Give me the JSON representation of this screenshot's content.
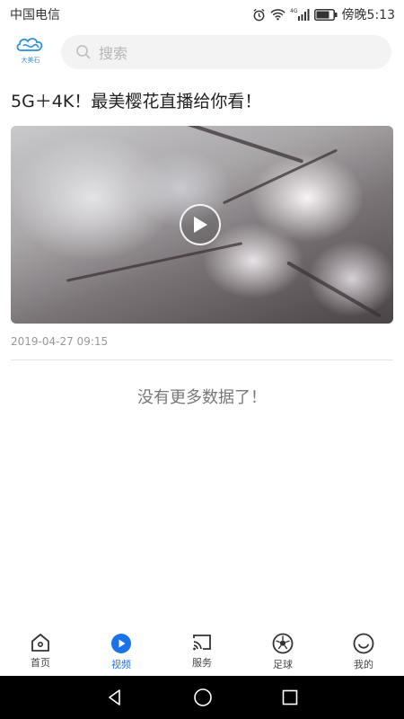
{
  "status_bar": {
    "carrier": "中国电信",
    "time": "傍晚5:13",
    "network": "4G"
  },
  "header": {
    "logo_text": "大美石",
    "search_placeholder": "搜索"
  },
  "article": {
    "title": "5G＋4K！最美樱花直播给你看！",
    "date": "2019-04-27 09:15"
  },
  "list_end_text": "没有更多数据了！",
  "tabs": [
    {
      "label": "首页",
      "icon": "home-icon",
      "active": false
    },
    {
      "label": "视频",
      "icon": "play-circle-icon",
      "active": true
    },
    {
      "label": "服务",
      "icon": "cast-icon",
      "active": false
    },
    {
      "label": "足球",
      "icon": "soccer-ball-icon",
      "active": false
    },
    {
      "label": "我的",
      "icon": "smile-icon",
      "active": false
    }
  ],
  "colors": {
    "accent": "#1a73e8",
    "tab_inactive": "#444444",
    "nav_bar": "#000000"
  }
}
